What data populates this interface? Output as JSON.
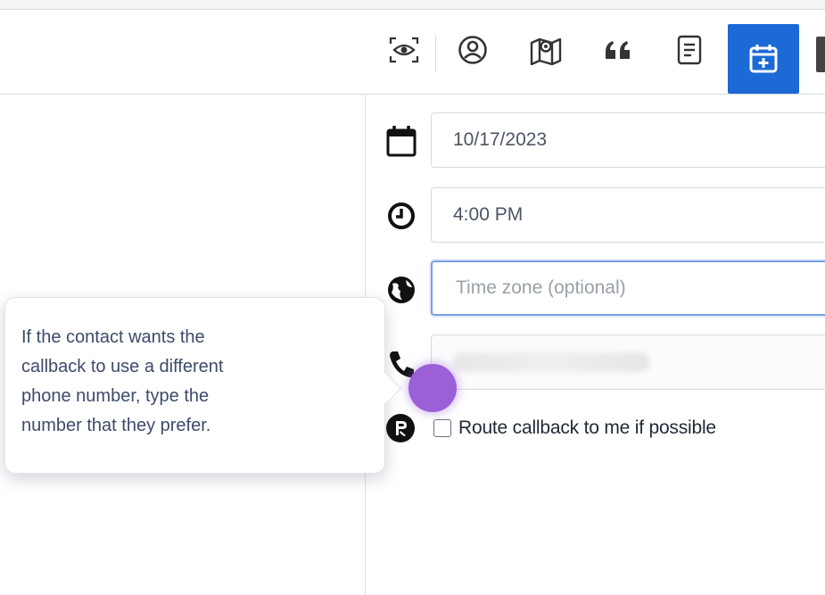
{
  "toolbar": {
    "buttons": [
      {
        "icon": "scan-face-icon"
      },
      {
        "icon": "user-circle-icon"
      },
      {
        "icon": "map-icon"
      },
      {
        "icon": "quote-icon"
      },
      {
        "icon": "document-icon"
      },
      {
        "icon": "calendar-add-icon",
        "active": true
      }
    ],
    "active_color": "#1b6ad6"
  },
  "form": {
    "date": {
      "icon": "calendar-icon",
      "value": "10/17/2023"
    },
    "time": {
      "icon": "clock-icon",
      "value": "4:00 PM"
    },
    "timezone": {
      "icon": "globe-icon",
      "value": "",
      "placeholder": "Time zone (optional)"
    },
    "phone": {
      "icon": "phone-icon",
      "value": ""
    },
    "route": {
      "icon": "route-badge-icon",
      "label": "Route callback to me if possible",
      "checked": false
    }
  },
  "tooltip": {
    "text": "If the contact wants the\ncallback to use a different\nphone number, type the\nnumber that they prefer."
  },
  "pointer": {
    "color": "#9b5fd8"
  }
}
